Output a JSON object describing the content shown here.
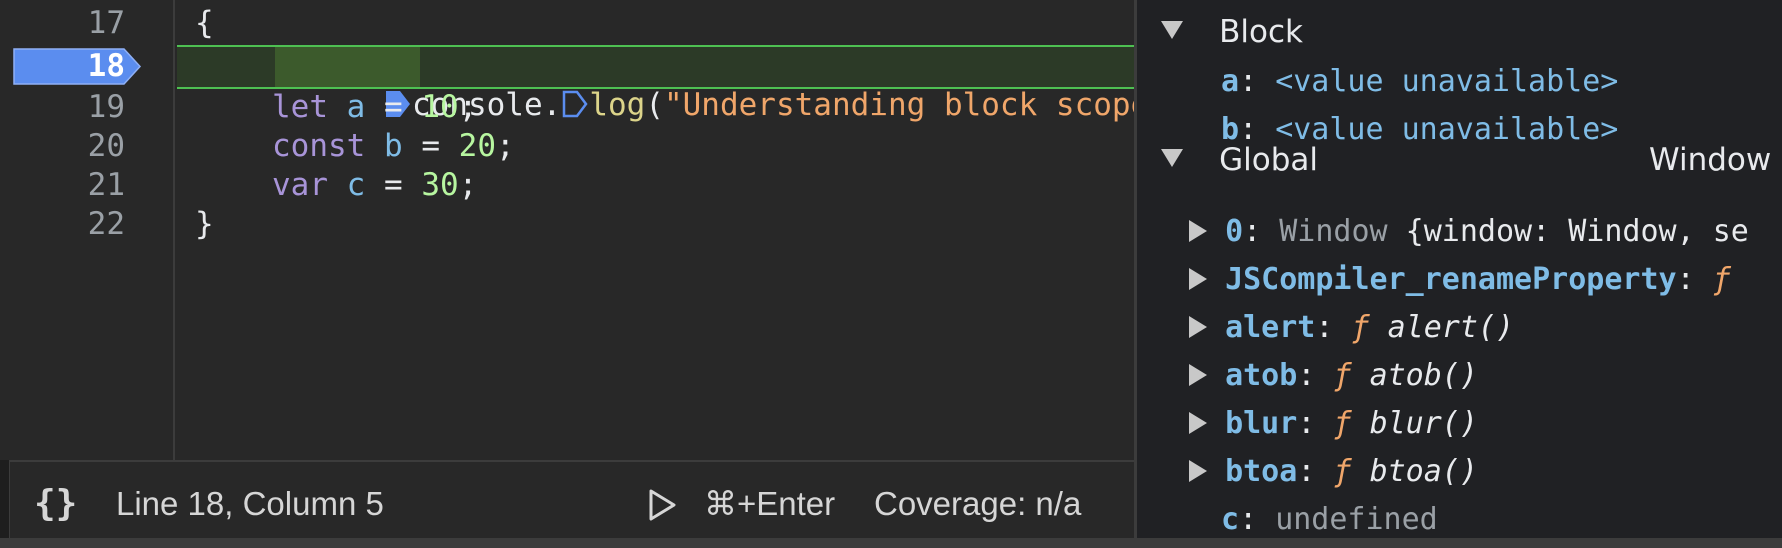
{
  "editor": {
    "lines": [
      {
        "number": "17",
        "text": "{"
      },
      {
        "number": "18",
        "active": true,
        "tokens": [
          "console",
          ".",
          "log",
          "(",
          "\"Understanding block scope\"",
          ")",
          ";"
        ]
      },
      {
        "number": "19",
        "tokens": [
          "let",
          " a",
          " = ",
          "10",
          ";"
        ]
      },
      {
        "number": "20",
        "tokens": [
          "const",
          " b",
          " = ",
          "20",
          ";"
        ]
      },
      {
        "number": "21",
        "tokens": [
          "var",
          " c",
          " = ",
          "30",
          ";"
        ]
      },
      {
        "number": "22",
        "text": "}"
      }
    ],
    "colors": {
      "breakpoint": "#5b8def",
      "executing_line_border": "#4ec052"
    }
  },
  "status_bar": {
    "pretty_print_icon": "{}",
    "cursor_position": "Line 18, Column 5",
    "run_shortcut": "⌘+Enter",
    "coverage": "Coverage: n/a"
  },
  "scope": {
    "block": {
      "title": "Block",
      "vars": [
        {
          "name": "a",
          "value": "<value unavailable>"
        },
        {
          "name": "b",
          "value": "<value unavailable>"
        }
      ]
    },
    "global": {
      "title": "Global",
      "value": "Window",
      "items": [
        {
          "name": "0",
          "value_type": "Window",
          "value_rest": " {window: Window, se"
        },
        {
          "name": "JSCompiler_renameProperty",
          "f": "ƒ"
        },
        {
          "name": "alert",
          "f": "ƒ",
          "fn": "alert()"
        },
        {
          "name": "atob",
          "f": "ƒ",
          "fn": "atob()"
        },
        {
          "name": "blur",
          "f": "ƒ",
          "fn": "blur()"
        },
        {
          "name": "btoa",
          "f": "ƒ",
          "fn": "btoa()"
        },
        {
          "name": "c",
          "value": "undefined"
        }
      ]
    }
  }
}
